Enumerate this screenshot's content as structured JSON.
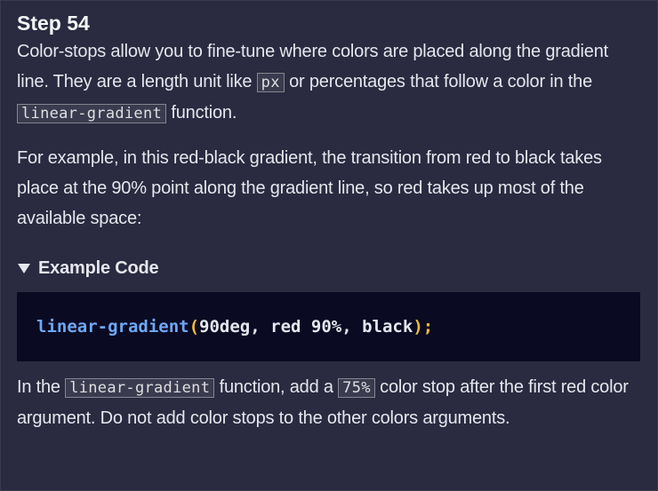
{
  "step": {
    "title": "Step 54"
  },
  "para1": {
    "t1": "Color-stops allow you to fine-tune where colors are placed along the gradient line. They are a length unit like ",
    "code1": "px",
    "t2": " or percentages that follow a color in the ",
    "code2": "linear-gradient",
    "t3": " function."
  },
  "para2": {
    "text": "For example, in this red-black gradient, the transition from red to black takes place at the 90% point along the gradient line, so red takes up most of the available space:"
  },
  "example": {
    "summary_label": "Example Code",
    "code": {
      "fn": "linear-gradient",
      "open": "(",
      "arg1": "90deg",
      "sep1": ", ",
      "arg2": "red 90%",
      "sep2": ", ",
      "arg3": "black",
      "close": ")",
      "end": ";"
    }
  },
  "para3": {
    "t1": "In the ",
    "code1": "linear-gradient",
    "t2": " function, add a ",
    "code2": "75%",
    "t3": " color stop after the first red color argument. Do not add color stops to the other colors arguments."
  },
  "colors": {
    "background": "#2a2a40",
    "code_background": "#0a0a23",
    "inline_code_background": "#3b3b4f",
    "function_token": "#6ea8f5",
    "paren_token": "#f1be32"
  },
  "icons": {
    "summary_toggle": "triangle-down-icon"
  }
}
